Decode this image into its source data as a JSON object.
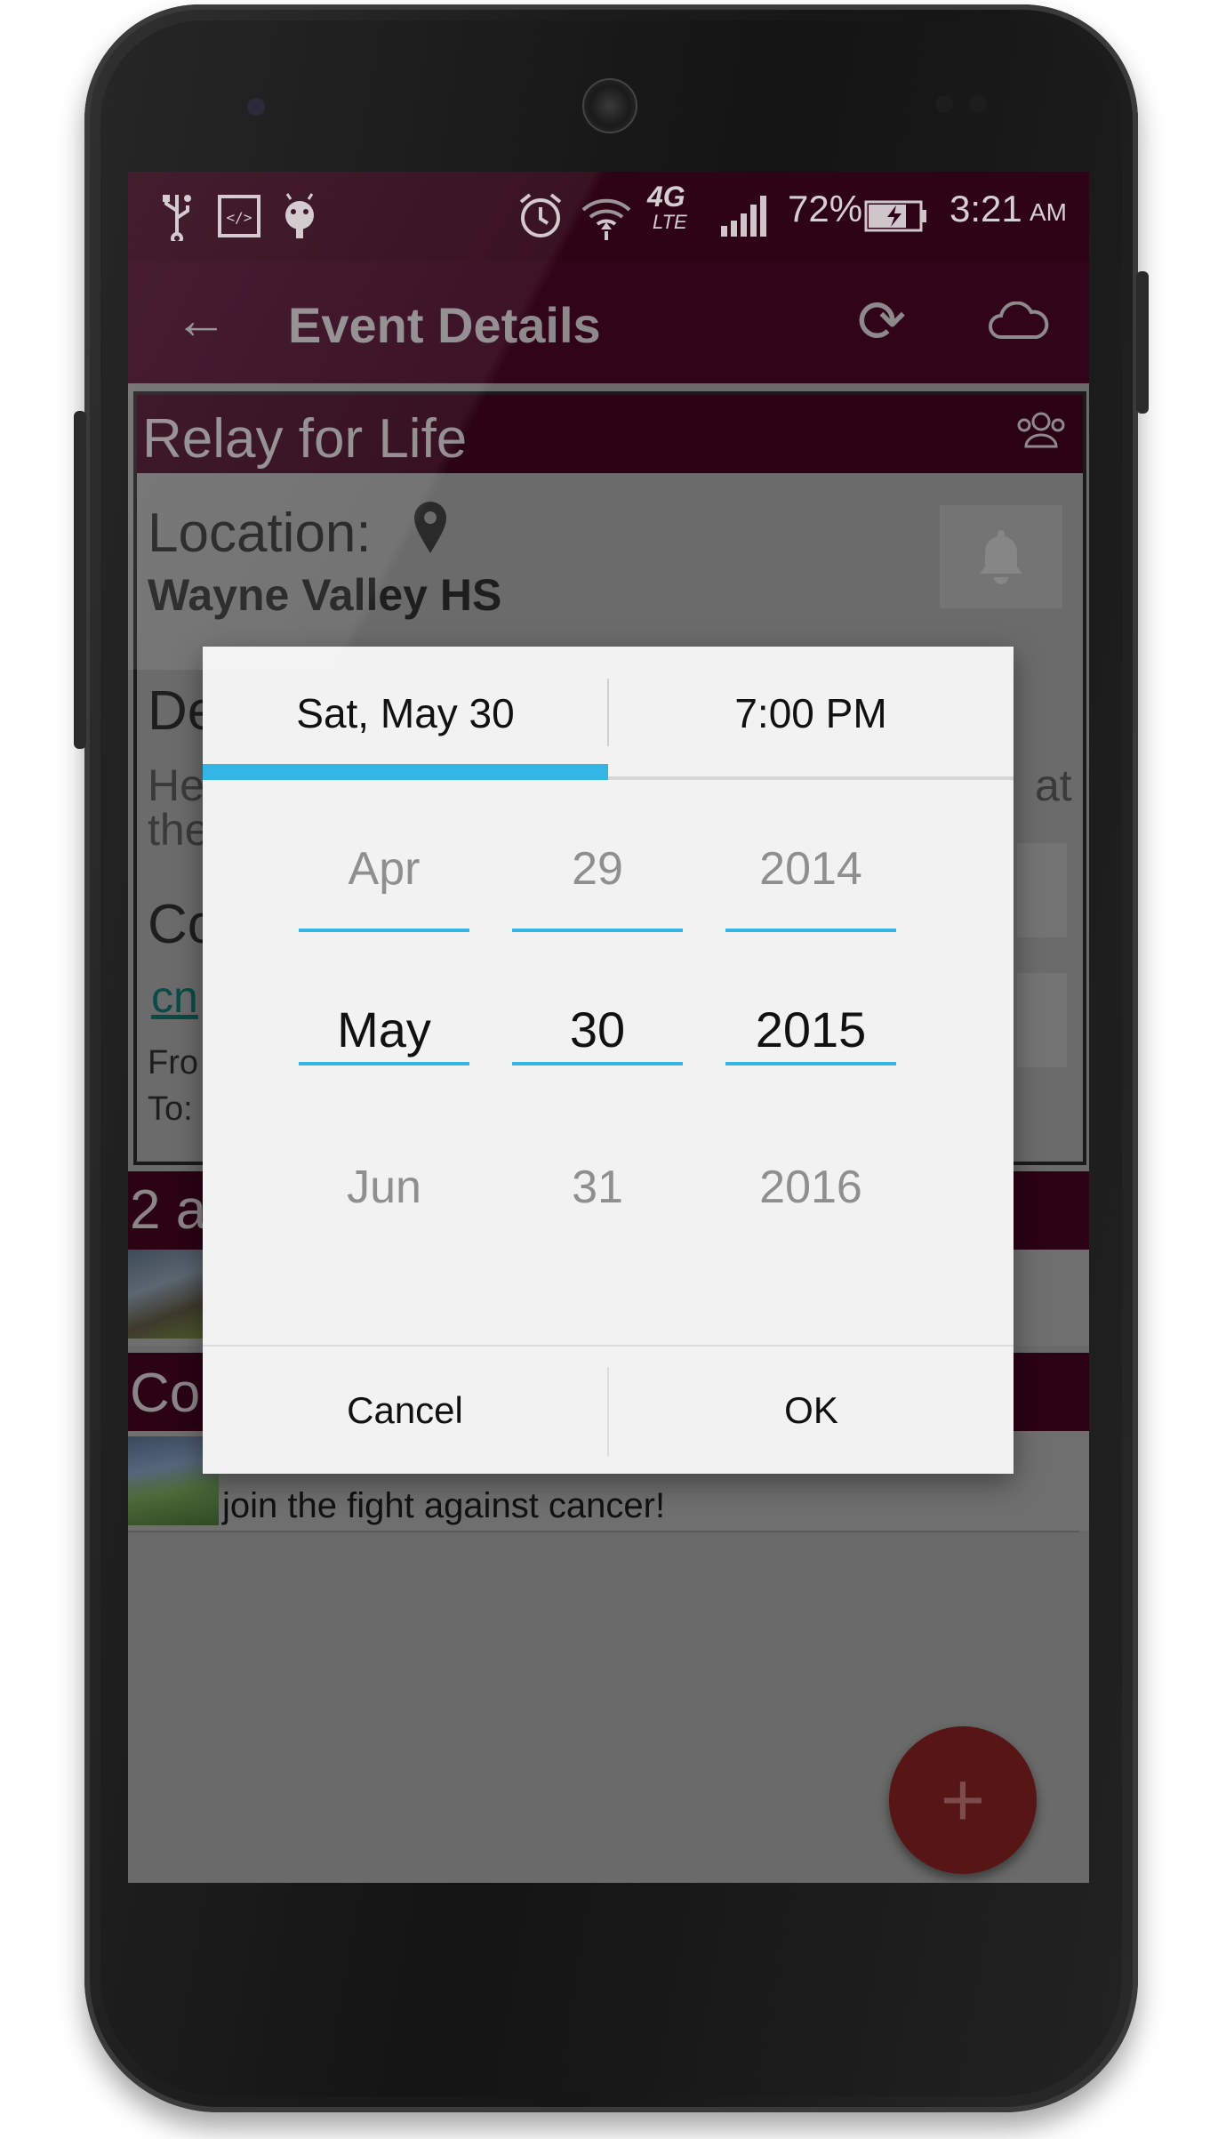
{
  "status_bar": {
    "battery": "72%",
    "time": "3:21",
    "ampm": "AM",
    "network": "4G",
    "network_sub": "LTE"
  },
  "app_bar": {
    "title": "Event Details"
  },
  "event": {
    "name": "Relay for Life",
    "location_label": "Location:",
    "location_value": "Wayne Valley HS",
    "desc_frag": "De",
    "desc_line1": "He",
    "desc_line1_end": "at",
    "desc_line2": "the",
    "contact_frag": "Co",
    "contact_link_frag": "cn",
    "from_frag": "Fro",
    "to_frag": "To:"
  },
  "sections": {
    "attendees_frag": "2 a",
    "comments_frag": "Co"
  },
  "comment": {
    "text": "join the fight against cancer!"
  },
  "date_picker": {
    "date_tab": "Sat, May 30",
    "time_tab": "7:00 PM",
    "month": {
      "prev": "Apr",
      "current": "May",
      "next": "Jun"
    },
    "day": {
      "prev": "29",
      "current": "30",
      "next": "31"
    },
    "year": {
      "prev": "2014",
      "current": "2015",
      "next": "2016"
    },
    "cancel_label": "Cancel",
    "ok_label": "OK"
  },
  "colors": {
    "accent": "#33b5e5",
    "primary_dark": "#2e0415",
    "fab": "#571515"
  }
}
